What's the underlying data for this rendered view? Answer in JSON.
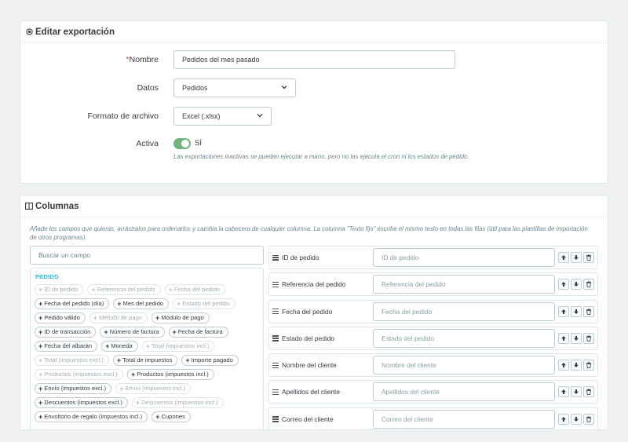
{
  "export_panel": {
    "title": "Editar exportación",
    "name_label": "Nombre",
    "name_required_mark": "*",
    "name_value": "Pedidos del mes pasado",
    "data_label": "Datos",
    "data_value": "Pedidos",
    "format_label": "Formato de archivo",
    "format_value": "Excel (.xlsx)",
    "active_label": "Activa",
    "active_state": "SÍ",
    "active_on": true,
    "help_text": "Las exportaciones inactivas se pueden ejecutar a mano, pero no las ejecuta el cron ni los estados de pedido."
  },
  "columns_panel": {
    "title": "Columnas",
    "description": "Añade los campos que quieras, arrástralos para ordenarlos y cambia la cabecera de cualquier columna. La columna \"Texto fijo\" escribe el mismo texto en todas las filas (útil para las plantillas de importación de otros programas).",
    "search_placeholder": "Buscar un campo",
    "group_title": "PEDIDO",
    "fields": [
      {
        "label": "ID de pedido",
        "enabled": false
      },
      {
        "label": "Referencia del pedido",
        "enabled": false
      },
      {
        "label": "Fecha del pedido",
        "enabled": false
      },
      {
        "label": "Fecha del pedido (día)",
        "enabled": true
      },
      {
        "label": "Mes del pedido",
        "enabled": true
      },
      {
        "label": "Estado del pedido",
        "enabled": false
      },
      {
        "label": "Pedido válido",
        "enabled": true
      },
      {
        "label": "Método de pago",
        "enabled": false
      },
      {
        "label": "Módulo de pago",
        "enabled": true
      },
      {
        "label": "ID de transacción",
        "enabled": true
      },
      {
        "label": "Número de factura",
        "enabled": true
      },
      {
        "label": "Fecha de factura",
        "enabled": true
      },
      {
        "label": "Fecha del albarán",
        "enabled": true
      },
      {
        "label": "Moneda",
        "enabled": true
      },
      {
        "label": "Total (impuestos incl.)",
        "enabled": false
      },
      {
        "label": "Total (impuestos excl.)",
        "enabled": false
      },
      {
        "label": "Total de impuestos",
        "enabled": true
      },
      {
        "label": "Importe pagado",
        "enabled": true
      },
      {
        "label": "Productos (impuestos excl.)",
        "enabled": false
      },
      {
        "label": "Productos (impuestos incl.)",
        "enabled": true
      },
      {
        "label": "Envío (impuestos excl.)",
        "enabled": true
      },
      {
        "label": "Envío (impuestos incl.)",
        "enabled": false
      },
      {
        "label": "Descuentos (impuestos excl.)",
        "enabled": true
      },
      {
        "label": "Descuentos (impuestos incl.)",
        "enabled": false
      },
      {
        "label": "Envoltorio de regalo (impuestos incl.)",
        "enabled": true
      },
      {
        "label": "Cupones",
        "enabled": true
      }
    ],
    "columns": [
      {
        "name": "ID de pedido",
        "header_placeholder": "ID de pedido"
      },
      {
        "name": "Referencia del pedido",
        "header_placeholder": "Referencia del pedido"
      },
      {
        "name": "Fecha del pedido",
        "header_placeholder": "Fecha del pedido"
      },
      {
        "name": "Estado del pedido",
        "header_placeholder": "Estado del pedido"
      },
      {
        "name": "Nombre del cliente",
        "header_placeholder": "Nombre del cliente"
      },
      {
        "name": "Apellidos del cliente",
        "header_placeholder": "Apellidos del cliente"
      },
      {
        "name": "Correo del cliente",
        "header_placeholder": "Correo del cliente"
      }
    ]
  },
  "icons": {
    "export_title": "circle-dot-icon",
    "columns_title": "columns-icon",
    "move_up": "arrow-up-icon",
    "move_down": "arrow-down-icon",
    "remove": "trash-icon",
    "drag": "drag-handle-icon",
    "add_field": "plus-icon"
  },
  "colors": {
    "accent": "#25b9d7",
    "toggle_on": "#70b580",
    "required": "#e04a4a"
  }
}
